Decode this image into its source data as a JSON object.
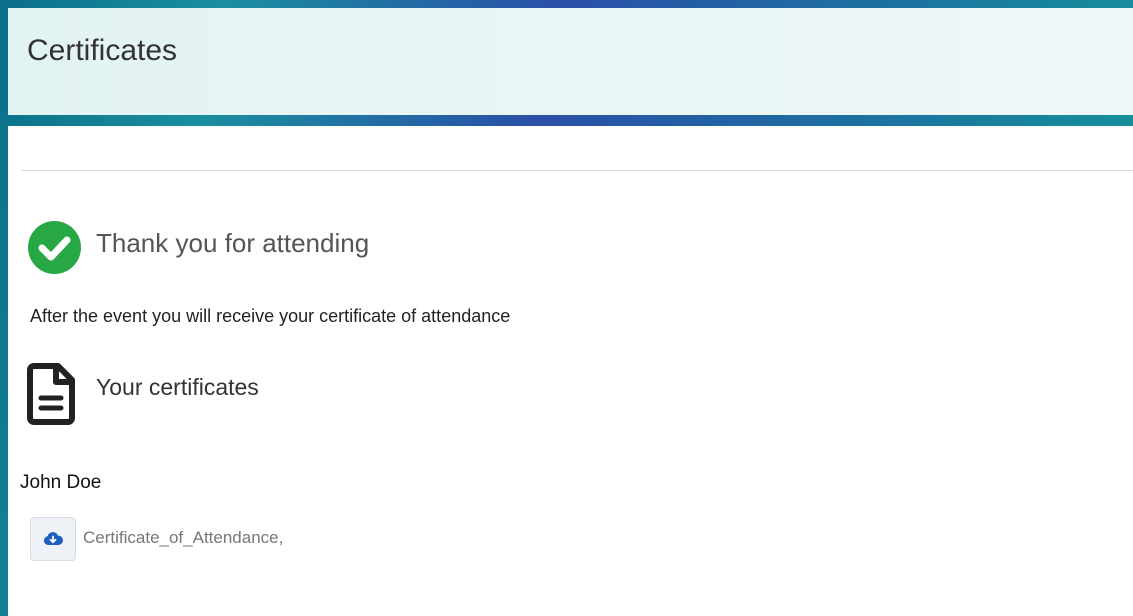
{
  "header": {
    "title": "Certificates"
  },
  "main": {
    "thanks_title": "Thank you for attending",
    "info_text": "After the event you will receive your certificate of attendance",
    "certificates_title": "Your certificates",
    "person_name": "John Doe",
    "file_label": "Certificate_of_Attendance,"
  },
  "icons": {
    "check": "check-circle-icon",
    "document": "document-icon",
    "download": "cloud-download-icon"
  },
  "colors": {
    "success": "#28a745",
    "download_icon": "#1f5fbf"
  }
}
